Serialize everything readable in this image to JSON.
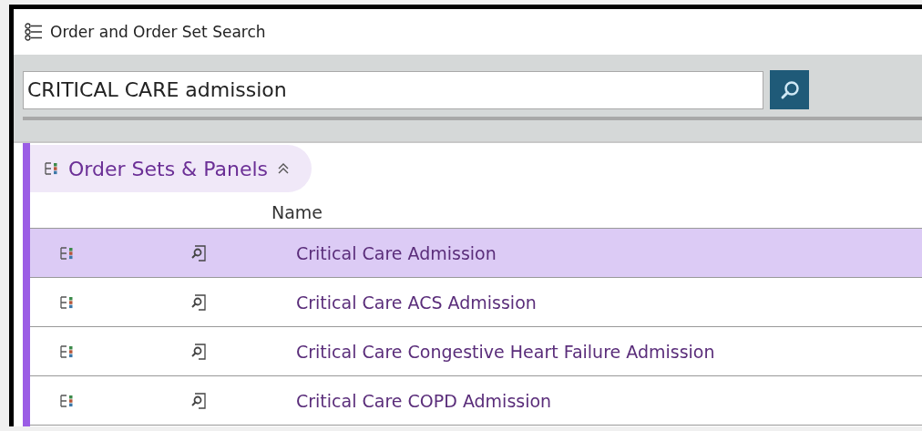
{
  "window": {
    "title": "Order and Order Set Search"
  },
  "search": {
    "value": "CRITICAL CARE admission"
  },
  "section": {
    "title": "Order Sets & Panels",
    "expanded": true
  },
  "table": {
    "columns": [
      "Name"
    ],
    "rows": [
      {
        "name": "Critical Care Admission",
        "selected": true
      },
      {
        "name": "Critical Care ACS Admission",
        "selected": false
      },
      {
        "name": "Critical Care Congestive Heart Failure Admission",
        "selected": false
      },
      {
        "name": "Critical Care COPD Admission",
        "selected": false
      }
    ]
  }
}
